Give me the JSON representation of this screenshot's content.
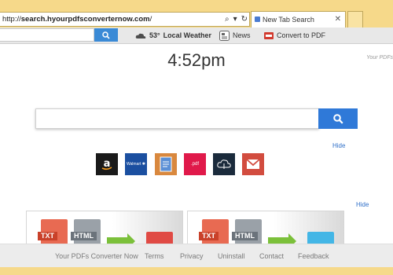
{
  "browser": {
    "address": {
      "prefix": "http://",
      "host": "search.hyourpdfsconverternow.com",
      "suffix": "/"
    },
    "tab": {
      "title": "New Tab Search",
      "close_glyph": "✕"
    }
  },
  "toolbar": {
    "weather": {
      "temp": "53°",
      "label": "Local Weather"
    },
    "news_label": "News",
    "convert_label": "Convert to PDF"
  },
  "page": {
    "clock": "4:52pm",
    "brand_tag": "Your PDFs"
  },
  "quicklinks": {
    "hide_label": "Hide",
    "tiles": [
      {
        "name": "Amazon",
        "glyph": "a"
      },
      {
        "name": "Walmart",
        "glyph": "Walmart ✱"
      },
      {
        "name": "Docs",
        "glyph": ""
      },
      {
        "name": "PDF",
        "glyph": ".pdf"
      },
      {
        "name": "Cloud",
        "glyph": ""
      },
      {
        "name": "Mail",
        "glyph": ""
      }
    ]
  },
  "cards": {
    "hide_label": "Hide",
    "items": [
      {
        "from": [
          "TXT",
          "HTML"
        ]
      },
      {
        "from": [
          "TXT",
          "HTML"
        ]
      }
    ]
  },
  "footer": {
    "links": [
      "Your PDFs Converter Now",
      "Terms",
      "Privacy",
      "Uninstall",
      "Contact",
      "Feedback"
    ]
  },
  "colors": {
    "chrome": "#f6d98a",
    "accent_blue": "#2f79d8",
    "link_blue": "#2f6fc8"
  }
}
